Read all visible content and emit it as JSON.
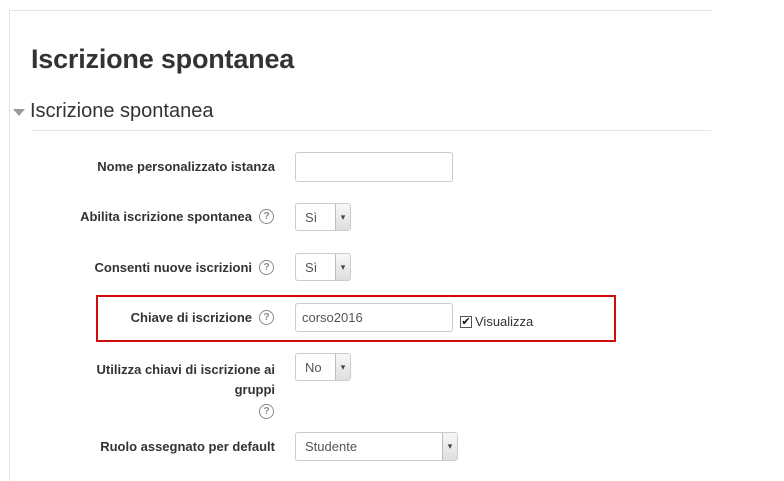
{
  "page": {
    "title": "Iscrizione spontanea"
  },
  "section": {
    "legend": "Iscrizione spontanea"
  },
  "fields": {
    "custom_name": {
      "label": "Nome personalizzato istanza",
      "value": ""
    },
    "enable": {
      "label": "Abilita iscrizione spontanea",
      "value": "Sì"
    },
    "allow_new": {
      "label": "Consenti nuove iscrizioni",
      "value": "Sì"
    },
    "enrol_key": {
      "label": "Chiave di iscrizione",
      "value": "corso2016",
      "show_label": "Visualizza",
      "show_checked": true
    },
    "group_keys": {
      "label_line1": "Utilizza chiavi di iscrizione ai",
      "label_line2": "gruppi",
      "value": "No"
    },
    "default_role": {
      "label": "Ruolo assegnato per default",
      "value": "Studente"
    }
  },
  "icons": {
    "help": "?",
    "check": "✔",
    "dropdown": "▾"
  },
  "colors": {
    "highlight_border": "#d10c0c"
  }
}
